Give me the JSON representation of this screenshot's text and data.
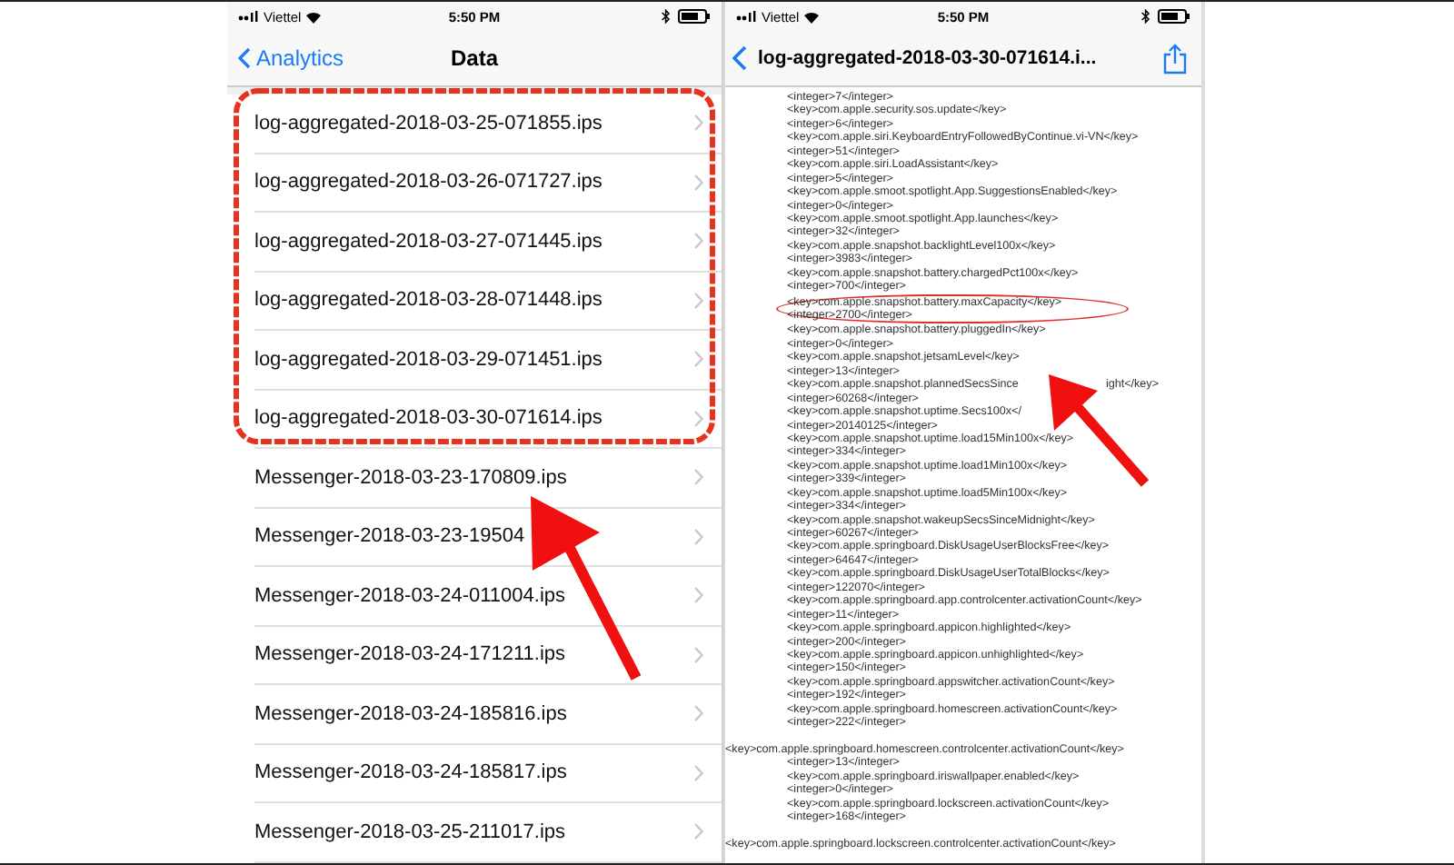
{
  "left_screen": {
    "status_bar": {
      "carrier": "Viettel",
      "time": "5:50 PM"
    },
    "nav": {
      "back": "Analytics",
      "title": "Data"
    },
    "files": [
      {
        "name": "log-aggregated-2018-03-25-071855.ips"
      },
      {
        "name": "log-aggregated-2018-03-26-071727.ips"
      },
      {
        "name": "log-aggregated-2018-03-27-071445.ips"
      },
      {
        "name": "log-aggregated-2018-03-28-071448.ips"
      },
      {
        "name": "log-aggregated-2018-03-29-071451.ips"
      },
      {
        "name": "log-aggregated-2018-03-30-071614.ips"
      },
      {
        "name": "Messenger-2018-03-23-170809.ips"
      },
      {
        "name": "Messenger-2018-03-23-19504"
      },
      {
        "name": "Messenger-2018-03-24-011004.ips"
      },
      {
        "name": "Messenger-2018-03-24-171211.ips"
      },
      {
        "name": "Messenger-2018-03-24-185816.ips"
      },
      {
        "name": "Messenger-2018-03-24-185817.ips"
      },
      {
        "name": "Messenger-2018-03-25-211017.ips"
      }
    ]
  },
  "right_screen": {
    "status_bar": {
      "carrier": "Viettel",
      "time": "5:50 PM"
    },
    "nav": {
      "title": "log-aggregated-2018-03-30-071614.i..."
    },
    "lines": [
      {
        "kind": "indented",
        "circled": false,
        "text": "<integer>7</integer>"
      },
      {
        "kind": "indented",
        "circled": false,
        "text": "<key>com.apple.security.sos.update</key>"
      },
      {
        "kind": "indented",
        "circled": false,
        "text": "<integer>6</integer>"
      },
      {
        "kind": "indented",
        "circled": false,
        "text": "<key>com.apple.siri.KeyboardEntryFollowedByContinue.vi-VN</key>"
      },
      {
        "kind": "indented",
        "circled": false,
        "text": "<integer>51</integer>"
      },
      {
        "kind": "indented",
        "circled": false,
        "text": "<key>com.apple.siri.LoadAssistant</key>"
      },
      {
        "kind": "indented",
        "circled": false,
        "text": "<integer>5</integer>"
      },
      {
        "kind": "indented",
        "circled": false,
        "text": "<key>com.apple.smoot.spotlight.App.SuggestionsEnabled</key>"
      },
      {
        "kind": "indented",
        "circled": false,
        "text": "<integer>0</integer>"
      },
      {
        "kind": "indented",
        "circled": false,
        "text": "<key>com.apple.smoot.spotlight.App.launches</key>"
      },
      {
        "kind": "indented",
        "circled": false,
        "text": "<integer>32</integer>"
      },
      {
        "kind": "indented",
        "circled": false,
        "text": "<key>com.apple.snapshot.backlightLevel100x</key>"
      },
      {
        "kind": "indented",
        "circled": false,
        "text": "<integer>3983</integer>"
      },
      {
        "kind": "indented",
        "circled": false,
        "text": "<key>com.apple.snapshot.battery.chargedPct100x</key>"
      },
      {
        "kind": "indented",
        "circled": false,
        "text": "<integer>700</integer>"
      },
      {
        "kind": "indented",
        "circled": true,
        "text": "<key>com.apple.snapshot.battery.maxCapacity</key>"
      },
      {
        "kind": "indented",
        "circled": true,
        "text": "<integer>2700</integer>"
      },
      {
        "kind": "indented",
        "circled": false,
        "text": "<key>com.apple.snapshot.battery.pluggedIn</key>"
      },
      {
        "kind": "indented",
        "circled": false,
        "text": "<integer>0</integer>"
      },
      {
        "kind": "indented",
        "circled": false,
        "text": "<key>com.apple.snapshot.jetsamLevel</key>"
      },
      {
        "kind": "indented",
        "circled": false,
        "text": "<integer>13</integer>"
      },
      {
        "kind": "indented",
        "circled": false,
        "text": "<key>com.apple.snapshot.plannedSecsSince",
        "text_after": "ight</key>"
      },
      {
        "kind": "indented",
        "circled": false,
        "text": "<integer>60268</integer>"
      },
      {
        "kind": "indented",
        "circled": false,
        "text": "<key>com.apple.snapshot.uptime.Secs100x</"
      },
      {
        "kind": "indented",
        "circled": false,
        "text": "<integer>20140125</integer>"
      },
      {
        "kind": "indented",
        "circled": false,
        "text": "<key>com.apple.snapshot.uptime.load15Min100x</key>"
      },
      {
        "kind": "indented",
        "circled": false,
        "text": "<integer>334</integer>"
      },
      {
        "kind": "indented",
        "circled": false,
        "text": "<key>com.apple.snapshot.uptime.load1Min100x</key>"
      },
      {
        "kind": "indented",
        "circled": false,
        "text": "<integer>339</integer>"
      },
      {
        "kind": "indented",
        "circled": false,
        "text": "<key>com.apple.snapshot.uptime.load5Min100x</key>"
      },
      {
        "kind": "indented",
        "circled": false,
        "text": "<integer>334</integer>"
      },
      {
        "kind": "indented",
        "circled": false,
        "text": "<key>com.apple.snapshot.wakeupSecsSinceMidnight</key>"
      },
      {
        "kind": "indented",
        "circled": false,
        "text": "<integer>60267</integer>"
      },
      {
        "kind": "indented",
        "circled": false,
        "text": "<key>com.apple.springboard.DiskUsageUserBlocksFree</key>"
      },
      {
        "kind": "indented",
        "circled": false,
        "text": "<integer>64647</integer>"
      },
      {
        "kind": "indented",
        "circled": false,
        "text": "<key>com.apple.springboard.DiskUsageUserTotalBlocks</key>"
      },
      {
        "kind": "indented",
        "circled": false,
        "text": "<integer>122070</integer>"
      },
      {
        "kind": "indented",
        "circled": false,
        "text": "<key>com.apple.springboard.app.controlcenter.activationCount</key>"
      },
      {
        "kind": "indented",
        "circled": false,
        "text": "<integer>11</integer>"
      },
      {
        "kind": "indented",
        "circled": false,
        "text": "<key>com.apple.springboard.appicon.highlighted</key>"
      },
      {
        "kind": "indented",
        "circled": false,
        "text": "<integer>200</integer>"
      },
      {
        "kind": "indented",
        "circled": false,
        "text": "<key>com.apple.springboard.appicon.unhighlighted</key>"
      },
      {
        "kind": "indented",
        "circled": false,
        "text": "<integer>150</integer>"
      },
      {
        "kind": "indented",
        "circled": false,
        "text": "<key>com.apple.springboard.appswitcher.activationCount</key>"
      },
      {
        "kind": "indented",
        "circled": false,
        "text": "<integer>192</integer>"
      },
      {
        "kind": "indented",
        "circled": false,
        "text": "<key>com.apple.springboard.homescreen.activationCount</key>"
      },
      {
        "kind": "indented",
        "circled": false,
        "text": "<integer>222</integer>"
      },
      {
        "kind": "outdented",
        "circled": false,
        "text": "<key>com.apple.springboard.homescreen.controlcenter.activationCount</key>"
      },
      {
        "kind": "indented",
        "circled": false,
        "text": "<integer>13</integer>"
      },
      {
        "kind": "indented",
        "circled": false,
        "text": "<key>com.apple.springboard.iriswallpaper.enabled</key>"
      },
      {
        "kind": "indented",
        "circled": false,
        "text": "<integer>0</integer>"
      },
      {
        "kind": "indented",
        "circled": false,
        "text": "<key>com.apple.springboard.lockscreen.activationCount</key>"
      },
      {
        "kind": "indented",
        "circled": false,
        "text": "<integer>168</integer>"
      },
      {
        "kind": "outdented",
        "circled": false,
        "text": "<key>com.apple.springboard.lockscreen.controlcenter.activationCount</key>"
      }
    ]
  }
}
